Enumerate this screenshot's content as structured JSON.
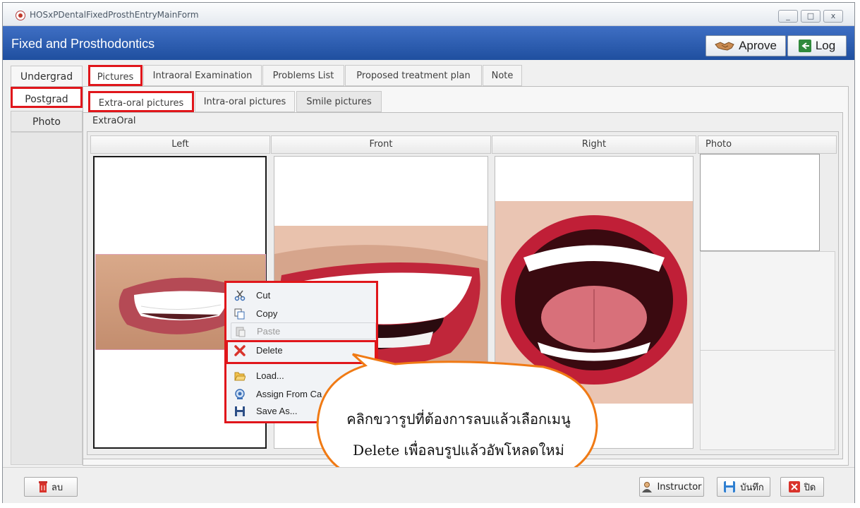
{
  "window": {
    "title": "HOSxPDentalFixedProsthEntryMainForm",
    "controls": {
      "minimize": "_",
      "maximize": "□",
      "close": "x"
    }
  },
  "header": {
    "title": "Fixed and Prosthodontics",
    "approve_label": "Aprove",
    "log_label": "Log"
  },
  "left_tabs": [
    "Undergrad",
    "Postgrad",
    "Photo"
  ],
  "top_tabs": [
    "Pictures",
    "Intraoral Examination",
    "Problems List",
    "Proposed treatment plan",
    "Note"
  ],
  "sub_tabs": [
    "Extra-oral pictures",
    "Intra-oral pictures",
    "Smile pictures"
  ],
  "group_title": "ExtraOral",
  "columns": [
    "Left",
    "Front",
    "Right",
    "Photo"
  ],
  "context_menu": {
    "items": [
      "Cut",
      "Copy",
      "Paste",
      "Delete",
      "Load...",
      "Assign From Ca",
      "Save As..."
    ]
  },
  "callout": {
    "line1": "คลิกขวารูปที่ต้องการลบแล้วเลือกเมนู",
    "line2": "Delete เพื่อลบรูปแล้วอัพโหลดใหม่"
  },
  "footer": {
    "delete_label": "ลบ",
    "instructor_label": "Instructor",
    "save_label": "บันทึก",
    "close_label": "ปิด"
  },
  "colors": {
    "header_blue": "#2b5aae",
    "highlight_red": "#e0161b",
    "callout_border": "#f07a14"
  }
}
